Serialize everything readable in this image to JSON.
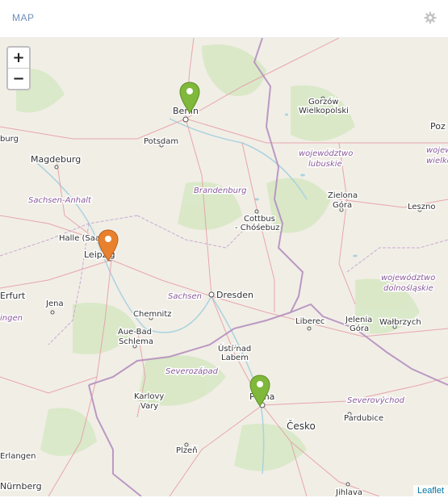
{
  "header": {
    "title": "MAP",
    "settings_icon": "gear-icon"
  },
  "zoom": {
    "in_label": "+",
    "out_label": "−"
  },
  "attribution": "Leaflet",
  "colors": {
    "marker_green": "#7fb83a",
    "marker_orange": "#e8812e",
    "water": "#aad3df",
    "forest": "#cfe3ba",
    "border": "#b58fbf",
    "road": "#e69aa4"
  },
  "labels": {
    "berlin": "Berlin",
    "potsdam": "Potsdam",
    "gorzow": "Gorzów",
    "wielkopolski": "Wielkopolski",
    "poz": "Poz",
    "magdeburg": "Magdeburg",
    "burg": "burg",
    "wojewodztwo1": "województwo",
    "lubuskie": "lubuskie",
    "wojew2": "wojew",
    "wielko2": "wielko",
    "sachsen_anhalt": "Sachsen-Anhalt",
    "brandenburg": "Brandenburg",
    "zielona": "Zielona",
    "gora": "Góra",
    "leszno": "Leszno",
    "cottbus": "Cottbus",
    "chosebuz": "- Chóśebuz",
    "halle": "Halle (Saale)",
    "leipzig": "Leipzig",
    "wojewodztwo3": "województwo",
    "dolnoslaskie": "dolnośląskie",
    "erfurt": "Erfurt",
    "jena": "Jena",
    "sachsen": "Sachsen",
    "dresden": "Dresden",
    "chemnitz": "Chemnitz",
    "ingen": "ingen",
    "aue_bad": "Aue-Bad",
    "schlema": "Schlema",
    "liberec": "Liberec",
    "jelenia": "Jelenia",
    "jgora": "Góra",
    "walbrzych": "Wałbrzych",
    "usti": "Ústí nad",
    "labem": "Labem",
    "severozapad": "Severozápad",
    "karlovy": "Karlovy",
    "vary": "Vary",
    "praha": "Praha",
    "severovychod": "Severovýchod",
    "pardubice": "Pardubice",
    "cesko": "Česko",
    "plzen": "Plzeň",
    "erlangen": "Erlangen",
    "nurnberg": "Nürnberg",
    "jihlava": "Jihlava"
  },
  "markers": [
    {
      "name": "Berlin",
      "color": "green"
    },
    {
      "name": "Leipzig",
      "color": "orange"
    },
    {
      "name": "Praha",
      "color": "green"
    }
  ]
}
